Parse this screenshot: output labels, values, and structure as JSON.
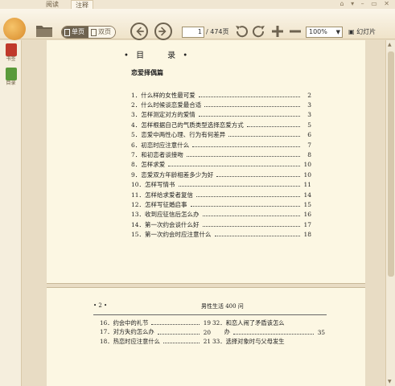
{
  "tabs": [
    {
      "label": "阅读",
      "active": false
    },
    {
      "label": "注释",
      "active": true
    }
  ],
  "window_controls": "⌂ ▾ – ▭ ✕",
  "toolbar": {
    "single_page_label": "单页",
    "double_page_label": "双页",
    "current_page": "1",
    "total_pages": "/ 474页",
    "zoom": "100%",
    "slideshow_label": "幻灯片"
  },
  "sidebar": [
    {
      "label": "书签",
      "icon": "bookmark-icon",
      "color": "#c0392b"
    },
    {
      "label": "目录",
      "icon": "toc-icon",
      "color": "#5a9a3a"
    }
  ],
  "page1": {
    "title": "• 目　　录 •",
    "section": "恋爱择偶篇",
    "entries": [
      {
        "text": "1．什么样的女性最可爱",
        "page": "2"
      },
      {
        "text": "2．什么时候谈恋爱最合适",
        "page": "3"
      },
      {
        "text": "3．怎样测定对方的爱情",
        "page": "3"
      },
      {
        "text": "4．怎样根据自己的气质类型选择恋爱方式",
        "page": "5"
      },
      {
        "text": "5．恋爱中两性心理、行为有何差异",
        "page": "6"
      },
      {
        "text": "6．初恋时应注意什么",
        "page": "7"
      },
      {
        "text": "7．和初恋者谈接吻",
        "page": "8"
      },
      {
        "text": "8．怎样求爱",
        "page": "10"
      },
      {
        "text": "9．恋爱双方年龄相差多少为好",
        "page": "10"
      },
      {
        "text": "10．怎样写情书",
        "page": "11"
      },
      {
        "text": "11．怎样给求爱者复信",
        "page": "14"
      },
      {
        "text": "12．怎样写征婚启事",
        "page": "15"
      },
      {
        "text": "13．收到应征信后怎么办",
        "page": "16"
      },
      {
        "text": "14．第一次约会谈什么好",
        "page": "17"
      },
      {
        "text": "15．第一次约会时应注意什么",
        "page": "18"
      }
    ]
  },
  "page2": {
    "page_number": "• 2 •",
    "running_title": "男性生活 400 问",
    "left_entries": [
      {
        "text": "16．约会中的礼节",
        "page": "19"
      },
      {
        "text": "17．对方失约怎么办",
        "page": "20"
      },
      {
        "text": "18．热恋时应注意什么",
        "page": "21"
      }
    ],
    "right_entries": [
      {
        "text": "32．和恋人闹了矛盾该怎么",
        "page": ""
      },
      {
        "text": "　　办",
        "page": "35"
      },
      {
        "text": "33．选择对象时与父母发生",
        "page": ""
      }
    ]
  }
}
